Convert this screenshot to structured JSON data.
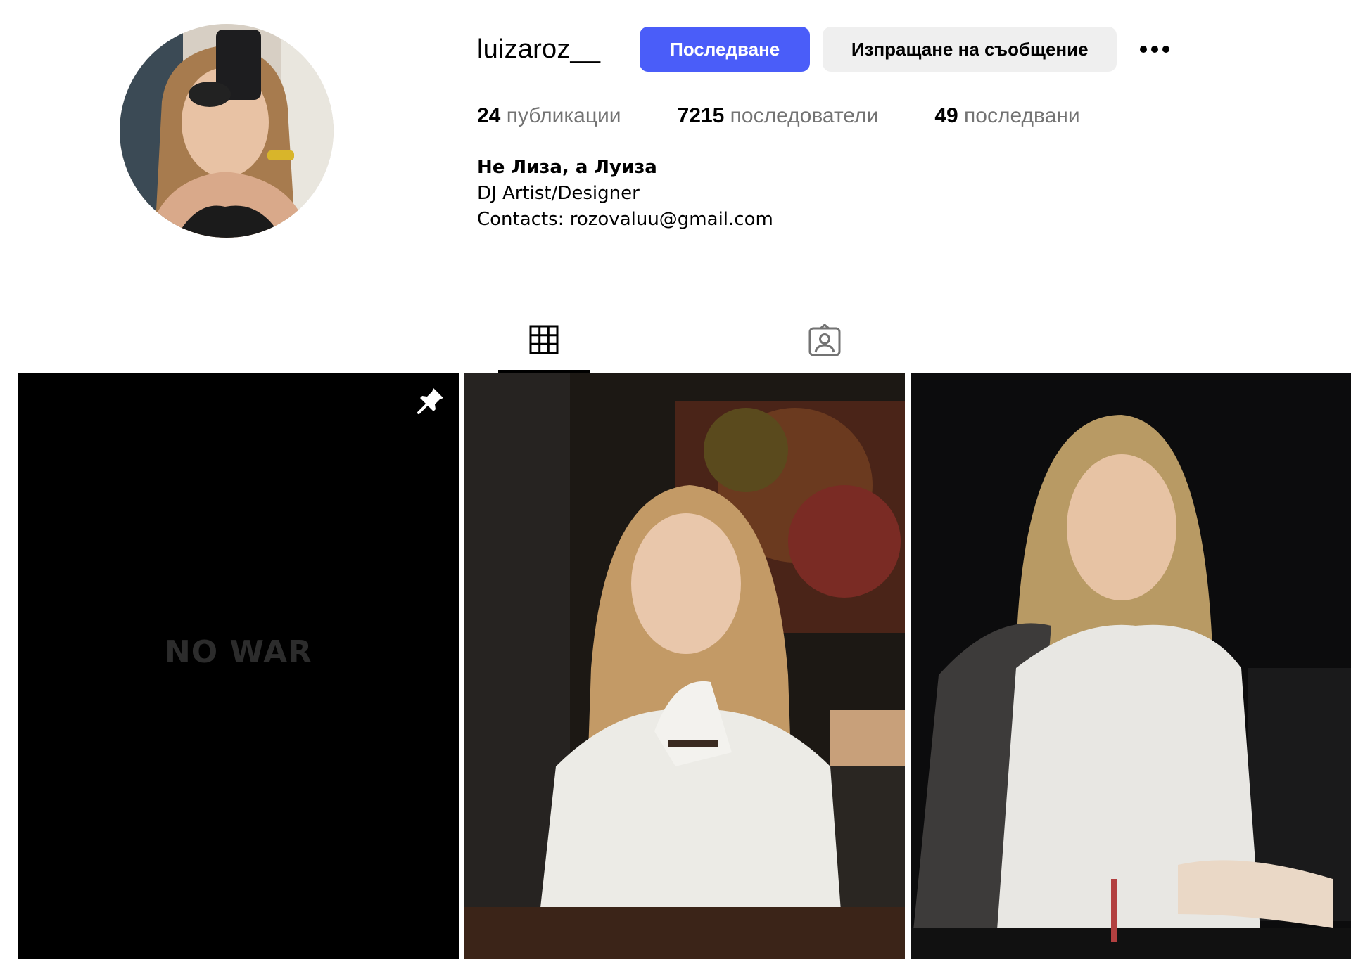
{
  "profile": {
    "username": "luizaroz__",
    "follow_label": "Последване",
    "message_label": "Изпращане на съобщение",
    "more_icon": "more-horizontal-icon",
    "avatar_icon": "profile-avatar"
  },
  "stats": {
    "posts_count": "24",
    "posts_label": "публикации",
    "followers_count": "7215",
    "followers_label": "последователи",
    "following_count": "49",
    "following_label": "последвани"
  },
  "bio": {
    "name": "Не Лиза, а Луиза",
    "line1": "DJ Artist/Designer",
    "line2": "Contacts: rozovaluu@gmail.com"
  },
  "tabs": [
    {
      "icon": "grid-icon",
      "active": true
    },
    {
      "icon": "tagged-icon",
      "active": false
    }
  ],
  "posts": [
    {
      "text": "NO WAR",
      "pinned": true
    },
    {
      "text": "",
      "pinned": false
    },
    {
      "text": "",
      "pinned": false
    }
  ],
  "colors": {
    "follow_button": "#4a5df9",
    "message_button": "#efefef",
    "stat_label": "#737373"
  }
}
